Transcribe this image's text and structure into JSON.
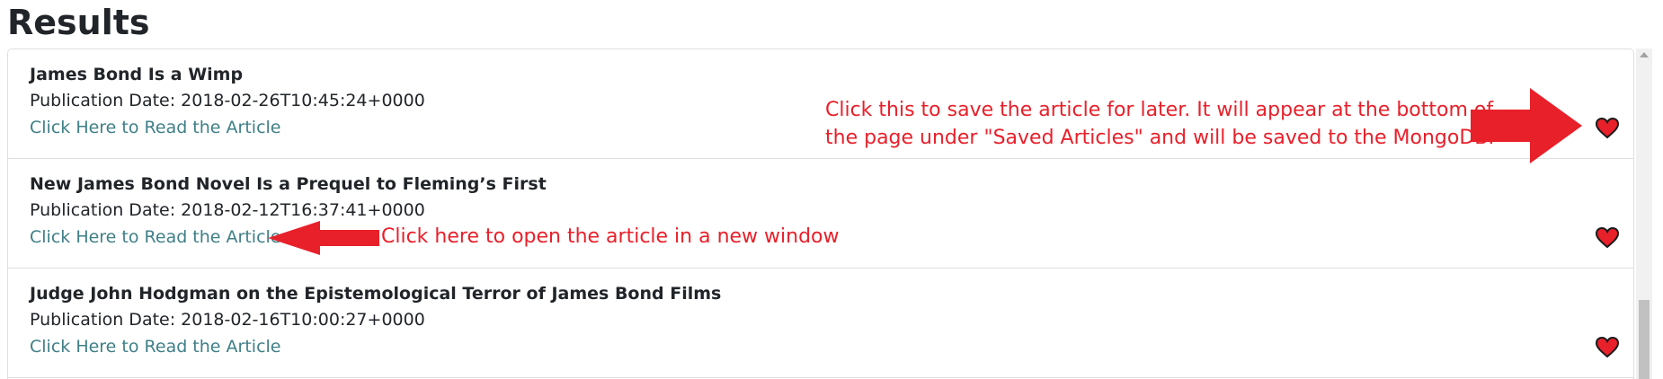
{
  "heading": "Results",
  "articles": [
    {
      "title": "James Bond Is a Wimp",
      "date": "Publication Date: 2018-02-26T10:45:24+0000",
      "link": "Click Here to Read the Article",
      "save_icon": "heart-icon"
    },
    {
      "title": "New James Bond Novel Is a Prequel to Fleming’s First",
      "date": "Publication Date: 2018-02-12T16:37:41+0000",
      "link": "Click Here to Read the Article",
      "save_icon": "heart-icon"
    },
    {
      "title": "Judge John Hodgman on the Epistemological Terror of James Bond Films",
      "date": "Publication Date: 2018-02-16T10:00:27+0000",
      "link": "Click Here to Read the Article",
      "save_icon": "heart-icon"
    }
  ],
  "annotations": {
    "save_line1": "Click this to save the article for later. It will appear at the bottom of",
    "save_line2": "the page under \"Saved Articles\" and will be saved to the MongoDB.",
    "open": "Click here to open the article in a new window"
  },
  "colors": {
    "annotation_red": "#e8202a",
    "link_teal": "#3f7f87",
    "heart_red": "#e8202a"
  }
}
